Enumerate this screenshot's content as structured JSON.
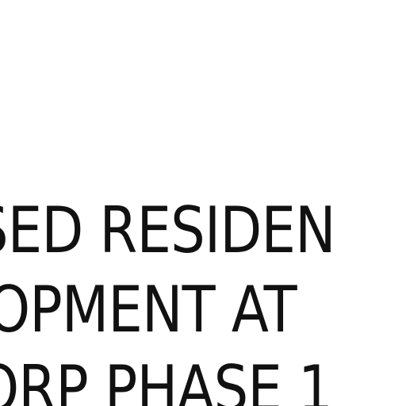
{
  "document": {
    "lines": [
      "SED RESIDEN",
      "OPMENT AT",
      "ORP PHASE 1"
    ]
  },
  "colors": {
    "background": "#ffffff",
    "text": "#111111"
  }
}
